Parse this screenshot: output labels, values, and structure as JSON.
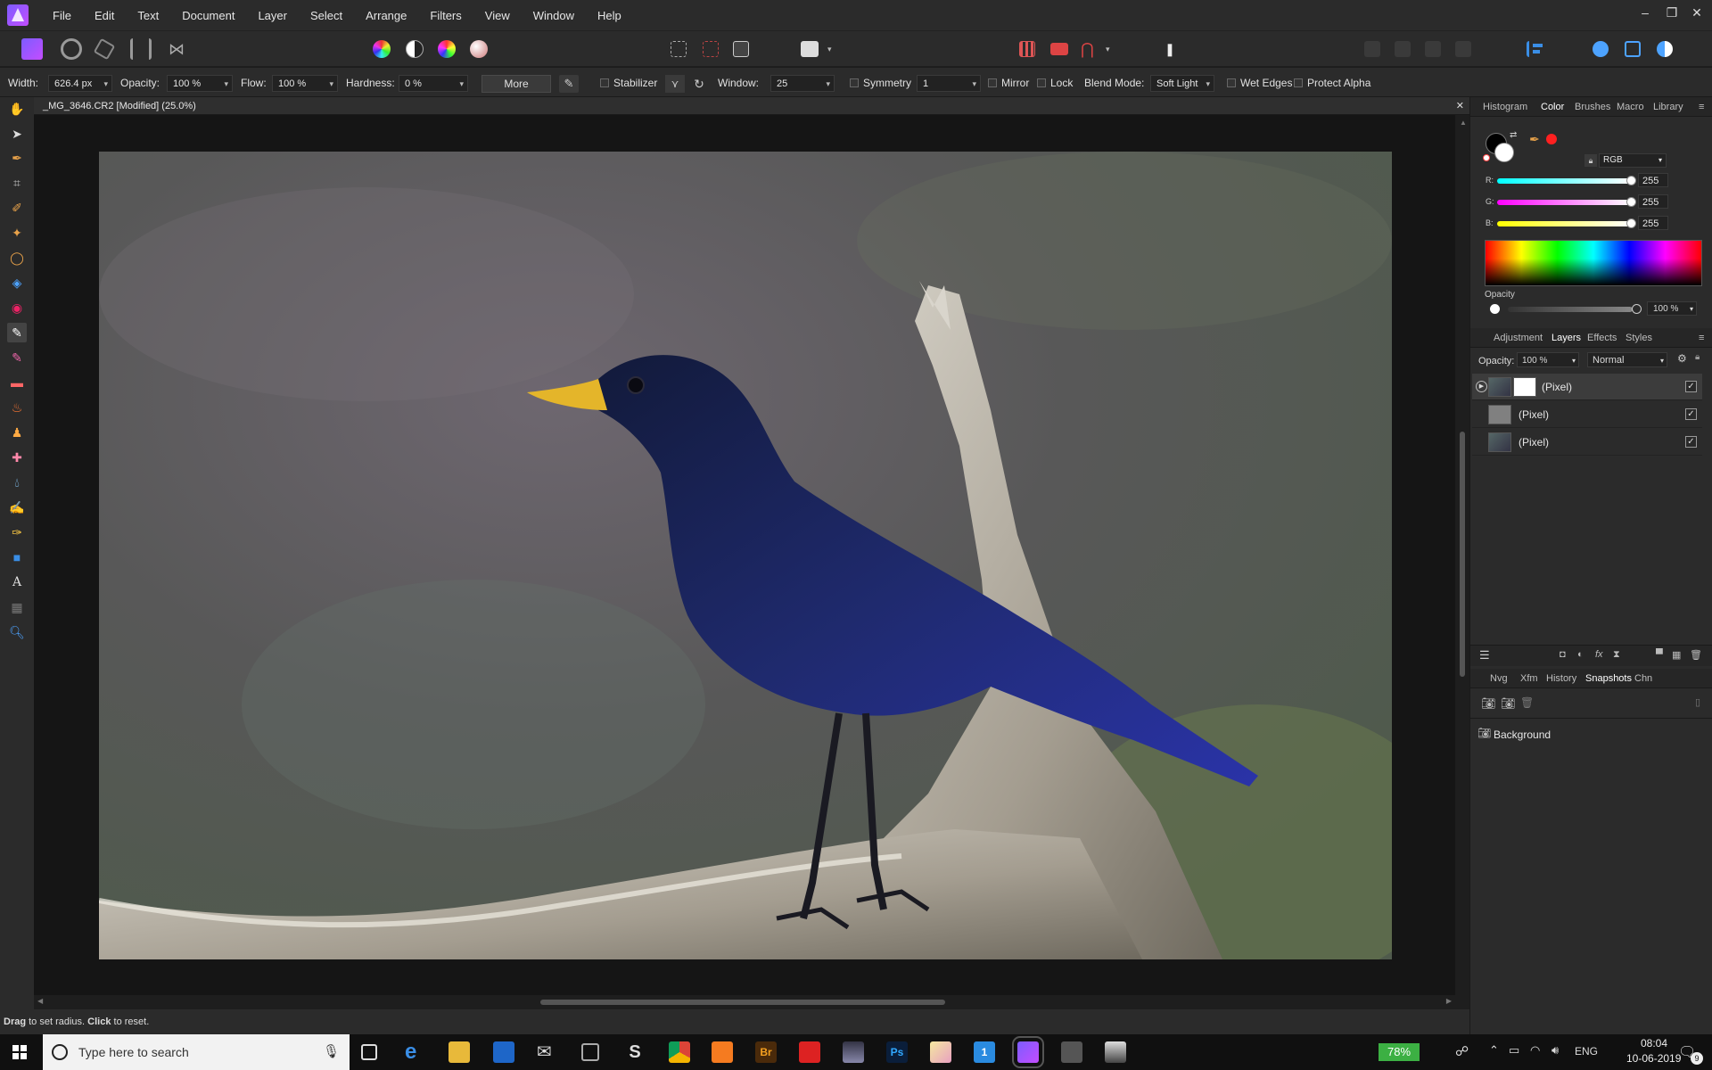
{
  "menubar": {
    "items": [
      "File",
      "Edit",
      "Text",
      "Document",
      "Layer",
      "Select",
      "Arrange",
      "Filters",
      "View",
      "Window",
      "Help"
    ],
    "window_controls": {
      "minimize": "–",
      "restore": "❐",
      "close": "✕"
    }
  },
  "context_toolbar": {
    "width_label": "Width:",
    "width_value": "626.4 px",
    "opacity_label": "Opacity:",
    "opacity_value": "100 %",
    "flow_label": "Flow:",
    "flow_value": "100 %",
    "hardness_label": "Hardness:",
    "hardness_value": "0 %",
    "more_label": "More",
    "stabilizer_label": "Stabilizer",
    "window_label": "Window:",
    "window_value": "25",
    "symmetry_label": "Symmetry",
    "symmetry_value": "1",
    "mirror_label": "Mirror",
    "lock_label": "Lock",
    "blend_label": "Blend Mode:",
    "blend_value": "Soft Light",
    "wet_edges_label": "Wet Edges",
    "protect_alpha_label": "Protect Alpha"
  },
  "document": {
    "tab_title": "_MG_3646.CR2 [Modified] (25.0%)",
    "close_glyph": "✕"
  },
  "status": {
    "drag": "Drag",
    "drag_text": " to set radius. ",
    "click": "Click",
    "click_text": " to reset."
  },
  "color_panel": {
    "tabs": [
      "Histogram",
      "Color",
      "Brushes",
      "Macro",
      "Library"
    ],
    "active_tab": "Color",
    "mode": "RGB",
    "r_label": "R:",
    "r_value": "255",
    "g_label": "G:",
    "g_value": "255",
    "b_label": "B:",
    "b_value": "255",
    "opacity_label": "Opacity",
    "opacity_value": "100 %",
    "accent_red": "#ff2020"
  },
  "layers_panel": {
    "tabs": [
      "Adjustment",
      "Layers",
      "Effects",
      "Styles"
    ],
    "active_tab": "Layers",
    "opacity_label": "Opacity:",
    "opacity_value": "100 %",
    "blend_value": "Normal",
    "layers": [
      {
        "name": "(Pixel)",
        "checked": "✓"
      },
      {
        "name": "(Pixel)",
        "checked": "✓"
      },
      {
        "name": "(Pixel)",
        "checked": "✓"
      }
    ]
  },
  "snapshots_panel": {
    "tabs": [
      "Nvg",
      "Xfm",
      "History",
      "Snapshots",
      "Chn"
    ],
    "active_tab": "Snapshots",
    "items": [
      "Background"
    ]
  },
  "taskbar": {
    "search_placeholder": "Type here to search",
    "battery": "78%",
    "language": "ENG",
    "time": "08:04",
    "date": "10-06-2019",
    "notification_count": "9"
  }
}
